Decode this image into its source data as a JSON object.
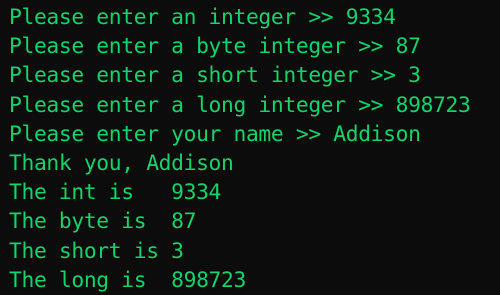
{
  "console": {
    "text_color": "#13d36b",
    "background_color": "#0c0c0c",
    "lines": [
      "Please enter an integer >> 9334",
      "Please enter a byte integer >> 87",
      "Please enter a short integer >> 3",
      "Please enter a long integer >> 898723",
      "Please enter your name >> Addison",
      "Thank you, Addison",
      "The int is   9334",
      "The byte is  87",
      "The short is 3",
      "The long is  898723"
    ]
  }
}
